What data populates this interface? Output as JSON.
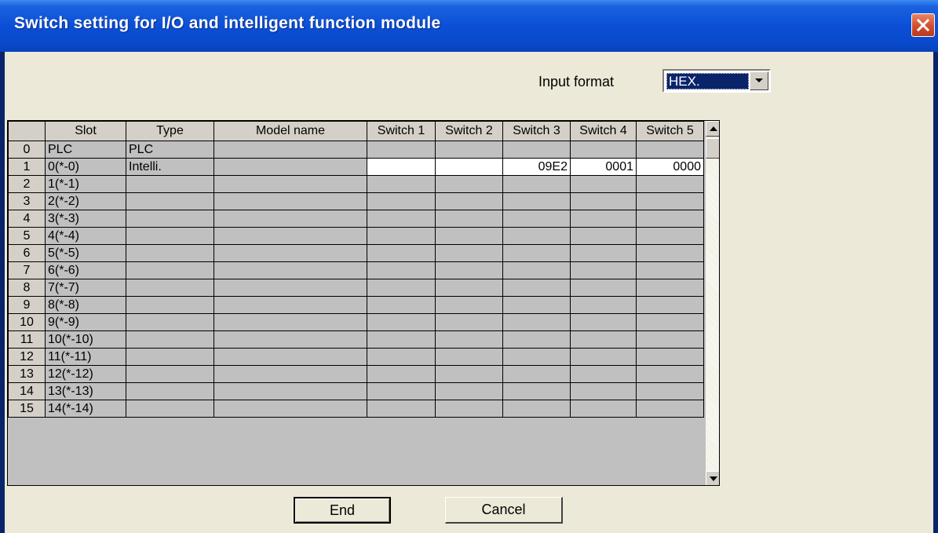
{
  "window": {
    "title": "Switch setting for I/O and intelligent function module"
  },
  "input_format": {
    "label": "Input format",
    "value": "HEX."
  },
  "table": {
    "headers": [
      "",
      "Slot",
      "Type",
      "Model name",
      "Switch 1",
      "Switch 2",
      "Switch 3",
      "Switch 4",
      "Switch 5"
    ],
    "rows": [
      {
        "num": "0",
        "slot": "PLC",
        "type": "PLC",
        "model": "",
        "sw1": "",
        "sw2": "",
        "sw3": "",
        "sw4": "",
        "sw5": ""
      },
      {
        "num": "1",
        "slot": "0(*-0)",
        "type": "Intelli.",
        "model": "",
        "sw1": "",
        "sw2": "",
        "sw3": "09E2",
        "sw4": "0001",
        "sw5": "0000"
      },
      {
        "num": "2",
        "slot": "1(*-1)",
        "type": "",
        "model": "",
        "sw1": "",
        "sw2": "",
        "sw3": "",
        "sw4": "",
        "sw5": ""
      },
      {
        "num": "3",
        "slot": "2(*-2)",
        "type": "",
        "model": "",
        "sw1": "",
        "sw2": "",
        "sw3": "",
        "sw4": "",
        "sw5": ""
      },
      {
        "num": "4",
        "slot": "3(*-3)",
        "type": "",
        "model": "",
        "sw1": "",
        "sw2": "",
        "sw3": "",
        "sw4": "",
        "sw5": ""
      },
      {
        "num": "5",
        "slot": "4(*-4)",
        "type": "",
        "model": "",
        "sw1": "",
        "sw2": "",
        "sw3": "",
        "sw4": "",
        "sw5": ""
      },
      {
        "num": "6",
        "slot": "5(*-5)",
        "type": "",
        "model": "",
        "sw1": "",
        "sw2": "",
        "sw3": "",
        "sw4": "",
        "sw5": ""
      },
      {
        "num": "7",
        "slot": "6(*-6)",
        "type": "",
        "model": "",
        "sw1": "",
        "sw2": "",
        "sw3": "",
        "sw4": "",
        "sw5": ""
      },
      {
        "num": "8",
        "slot": "7(*-7)",
        "type": "",
        "model": "",
        "sw1": "",
        "sw2": "",
        "sw3": "",
        "sw4": "",
        "sw5": ""
      },
      {
        "num": "9",
        "slot": "8(*-8)",
        "type": "",
        "model": "",
        "sw1": "",
        "sw2": "",
        "sw3": "",
        "sw4": "",
        "sw5": ""
      },
      {
        "num": "10",
        "slot": "9(*-9)",
        "type": "",
        "model": "",
        "sw1": "",
        "sw2": "",
        "sw3": "",
        "sw4": "",
        "sw5": ""
      },
      {
        "num": "11",
        "slot": "10(*-10)",
        "type": "",
        "model": "",
        "sw1": "",
        "sw2": "",
        "sw3": "",
        "sw4": "",
        "sw5": ""
      },
      {
        "num": "12",
        "slot": "11(*-11)",
        "type": "",
        "model": "",
        "sw1": "",
        "sw2": "",
        "sw3": "",
        "sw4": "",
        "sw5": ""
      },
      {
        "num": "13",
        "slot": "12(*-12)",
        "type": "",
        "model": "",
        "sw1": "",
        "sw2": "",
        "sw3": "",
        "sw4": "",
        "sw5": ""
      },
      {
        "num": "14",
        "slot": "13(*-13)",
        "type": "",
        "model": "",
        "sw1": "",
        "sw2": "",
        "sw3": "",
        "sw4": "",
        "sw5": ""
      },
      {
        "num": "15",
        "slot": "14(*-14)",
        "type": "",
        "model": "",
        "sw1": "",
        "sw2": "",
        "sw3": "",
        "sw4": "",
        "sw5": ""
      }
    ]
  },
  "buttons": {
    "end": "End",
    "cancel": "Cancel"
  },
  "icons": {
    "close": "close-icon",
    "dropdown": "chevron-down-icon",
    "scroll_up": "arrow-up-icon",
    "scroll_down": "arrow-down-icon"
  },
  "colors": {
    "titlebar": "#0b4fd6",
    "dialog_bg": "#ece9d8",
    "grid_bg": "#c0c0c0",
    "editable_cell": "#ffffff",
    "close_button": "#d24c2e",
    "selection": "#0a246a"
  }
}
